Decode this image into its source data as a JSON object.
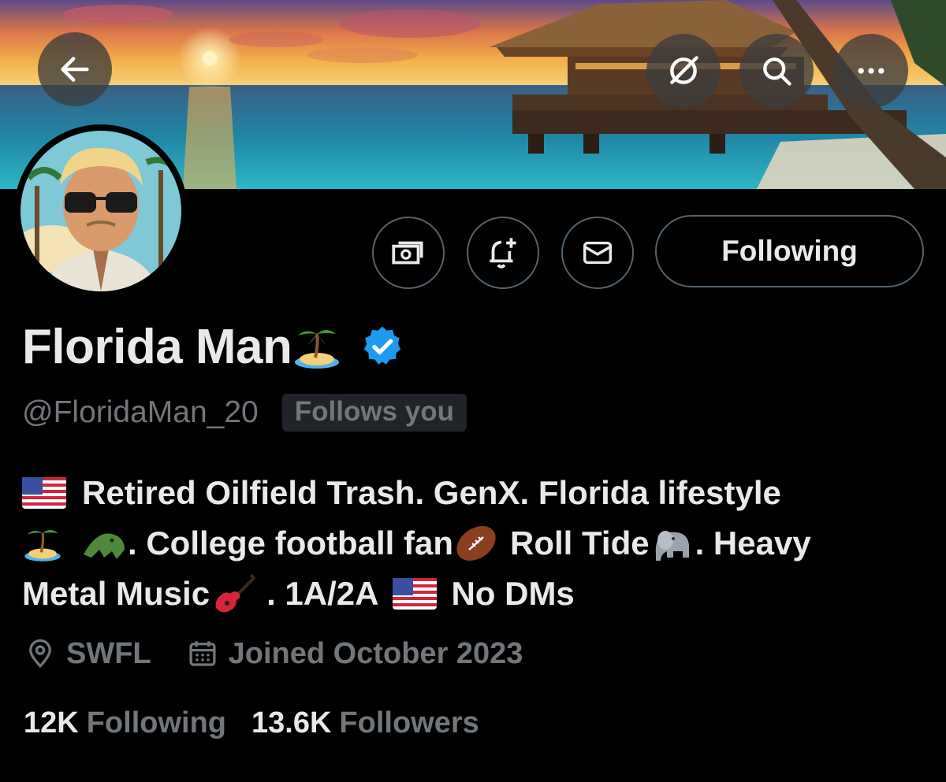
{
  "header": {
    "back_icon": "arrow-left-icon",
    "grok_icon": "grok-icon",
    "search_icon": "search-icon",
    "more_icon": "more-horizontal-icon"
  },
  "actions": {
    "subscribe_icon": "money-icon",
    "notify_icon": "bell-plus-icon",
    "message_icon": "envelope-icon",
    "following_label": "Following"
  },
  "profile": {
    "display_name": "Florida Man",
    "verified": true,
    "handle": "@FloridaMan_20",
    "follows_you_label": "Follows you",
    "bio": {
      "line1_text": "Retired Oilfield Trash. GenX. Florida lifestyle",
      "line2_text_a": ". College football fan",
      "line2_text_b": "Roll Tide",
      "line2_text_c": ". Heavy",
      "line3_text_a": "Metal Music",
      "line3_text_b": ". 1A/2A",
      "line3_text_c": "No DMs"
    },
    "location": "SWFL",
    "joined": "Joined October 2023",
    "following_count": "12K",
    "following_label": "Following",
    "followers_count": "13.6K",
    "followers_label": "Followers"
  },
  "colors": {
    "background": "#000000",
    "text_primary": "#e7e9ea",
    "text_secondary": "#71767b",
    "verified_blue": "#1d9bf0",
    "border": "#536471"
  }
}
